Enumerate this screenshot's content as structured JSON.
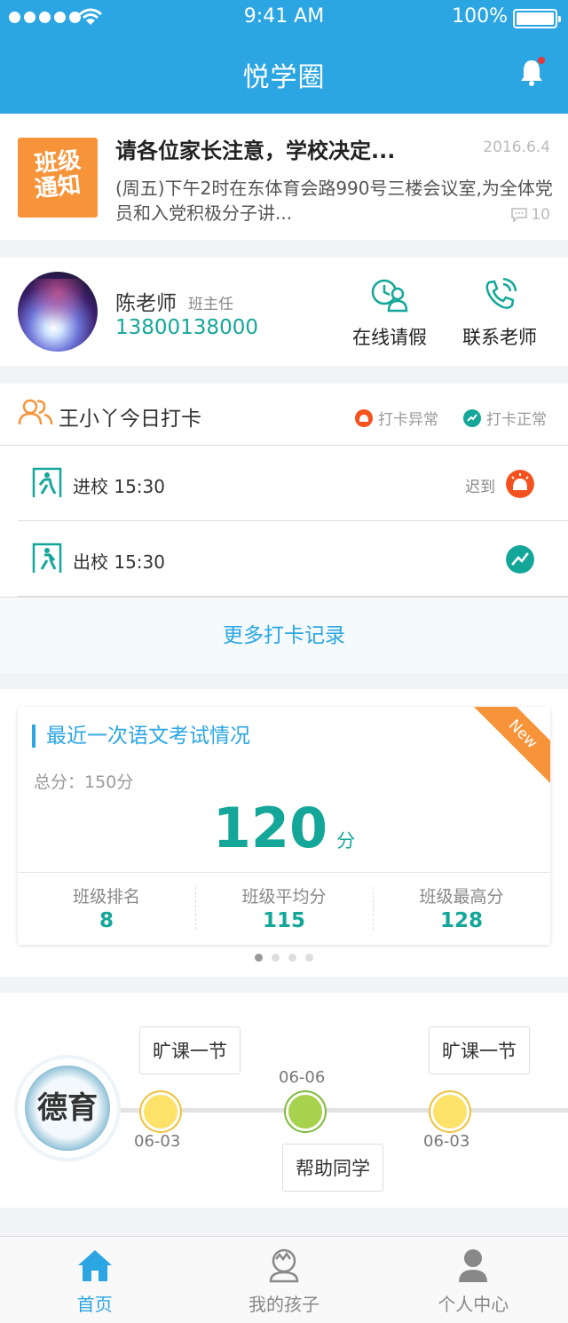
{
  "status_bar": {
    "time": "9:41 AM",
    "battery": "100%"
  },
  "header": {
    "title": "悦学圈"
  },
  "notice": {
    "badge": [
      "班级",
      "通知"
    ],
    "title": "请各位家长注意，学校决定...",
    "date": "2016.6.4",
    "body": "(周五)下午2时在东体育会路990号三楼会议室,为全体党员和入党积极分子讲...",
    "comments": "10"
  },
  "teacher": {
    "name": "陈老师",
    "role": "班主任",
    "phone": "13800138000",
    "actions": {
      "leave": "在线请假",
      "contact": "联系老师"
    }
  },
  "attendance": {
    "title": "王小丫今日打卡",
    "legend_abnormal": "打卡异常",
    "legend_normal": "打卡正常",
    "rows": [
      {
        "text": "进校  15:30",
        "status": "迟到"
      },
      {
        "text": "出校  15:30",
        "status": ""
      }
    ],
    "more": "更多打卡记录"
  },
  "exam": {
    "title": "最近一次语文考试情况",
    "ribbon": "New",
    "total": "总分：150分",
    "score": "120",
    "unit": "分",
    "stats": [
      {
        "label": "班级排名",
        "value": "8"
      },
      {
        "label": "班级平均分",
        "value": "115"
      },
      {
        "label": "班级最高分",
        "value": "128"
      }
    ],
    "pages": 4,
    "current_page": 1
  },
  "moral": {
    "badge": "德育",
    "events": [
      {
        "date": "06-03",
        "label": "旷课一节",
        "type": "bad"
      },
      {
        "date": "06-06",
        "label": "帮助同学",
        "type": "good"
      },
      {
        "date": "06-03",
        "label": "旷课一节",
        "type": "bad"
      }
    ]
  },
  "tabbar": {
    "items": [
      {
        "label": "首页",
        "icon": "home-icon",
        "active": true
      },
      {
        "label": "我的孩子",
        "icon": "child-icon",
        "active": false
      },
      {
        "label": "个人中心",
        "icon": "user-icon",
        "active": false
      }
    ]
  },
  "colors": {
    "primary": "#2ba6e3",
    "teal": "#14a799",
    "orange": "#f7943a",
    "alert": "#f4511e"
  }
}
